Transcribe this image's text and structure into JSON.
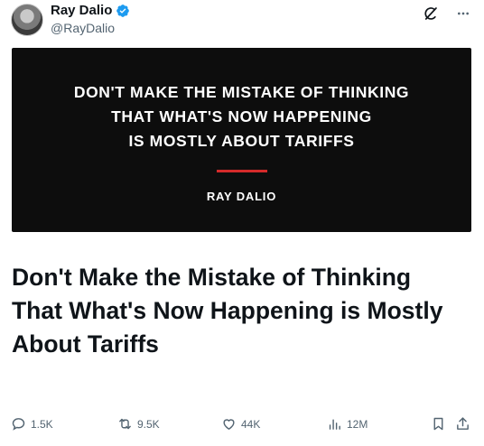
{
  "author": {
    "display_name": "Ray Dalio",
    "handle": "@RayDalio"
  },
  "media": {
    "quote_lines": [
      "DON'T MAKE THE MISTAKE OF THINKING",
      "THAT WHAT'S NOW HAPPENING",
      "IS MOSTLY ABOUT TARIFFS"
    ],
    "attribution": "RAY DALIO",
    "accent_color": "#d42a2a",
    "background_color": "#0d0d0d"
  },
  "headline": "Don't Make the Mistake of Thinking That What's Now Happening is Mostly About Tariffs",
  "actions": {
    "replies": "1.5K",
    "reposts": "9.5K",
    "likes": "44K",
    "views": "12M"
  },
  "icons": {
    "verified": "verified-badge-icon",
    "grok": "grok-icon",
    "more": "more-icon",
    "reply": "reply-icon",
    "repost": "repost-icon",
    "like": "like-icon",
    "views": "views-icon",
    "bookmark": "bookmark-icon",
    "share": "share-icon"
  },
  "colors": {
    "verified_blue": "#1d9bf0",
    "muted_text": "#536471"
  }
}
